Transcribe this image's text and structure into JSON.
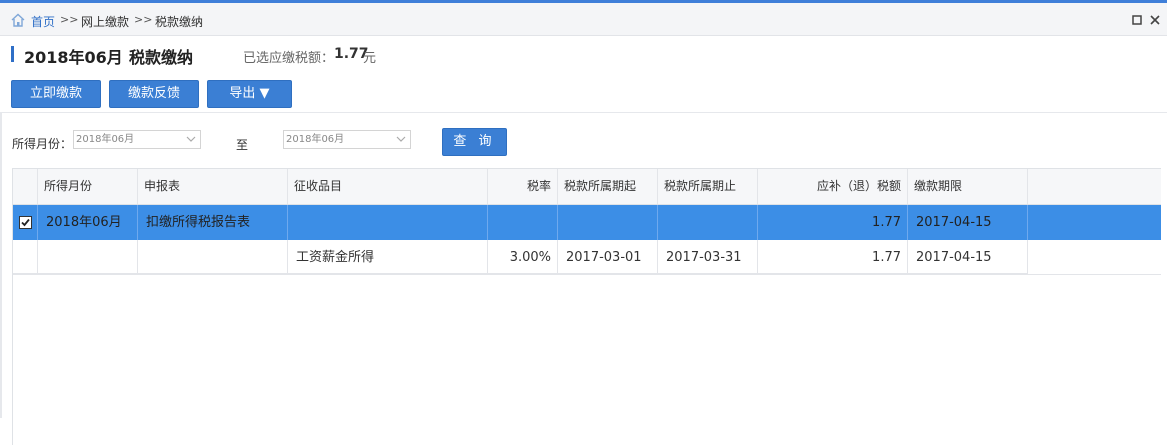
{
  "breadcrumb": {
    "home": "首页",
    "sep": ">>",
    "level1": "网上缴款",
    "level2": "税款缴纳"
  },
  "header": {
    "period": "2018年06月",
    "title": "税款缴纳",
    "selected_label": "已选应缴税额：",
    "selected_value": "1.77",
    "selected_unit": "元"
  },
  "toolbar": {
    "pay_now": "立即缴款",
    "feedback": "缴款反馈",
    "export": "导出 ▼"
  },
  "filter": {
    "month_label": "所得月份：",
    "from_value": "2018年06月",
    "to_label": "至",
    "to_value": "2018年06月",
    "query": "查 询"
  },
  "table": {
    "columns": [
      "所得月份",
      "申报表",
      "征收品目",
      "税率",
      "税款所属期起",
      "税款所属期止",
      "应补（退）税额",
      "缴款期限"
    ],
    "rows": [
      {
        "checked": true,
        "month": "2018年06月",
        "form": "扣缴所得税报告表",
        "item": "",
        "rate": "",
        "start": "",
        "end": "",
        "amount": "1.77",
        "deadline": "2017-04-15"
      },
      {
        "checked": false,
        "month": "",
        "form": "",
        "item": "工资薪金所得",
        "rate": "3.00%",
        "start": "2017-03-01",
        "end": "2017-03-31",
        "amount": "1.77",
        "deadline": "2017-04-15"
      }
    ]
  },
  "colors": {
    "accent": "#3b7fd4",
    "selected_row": "#3c8ee6",
    "link": "#2f6fc7"
  }
}
